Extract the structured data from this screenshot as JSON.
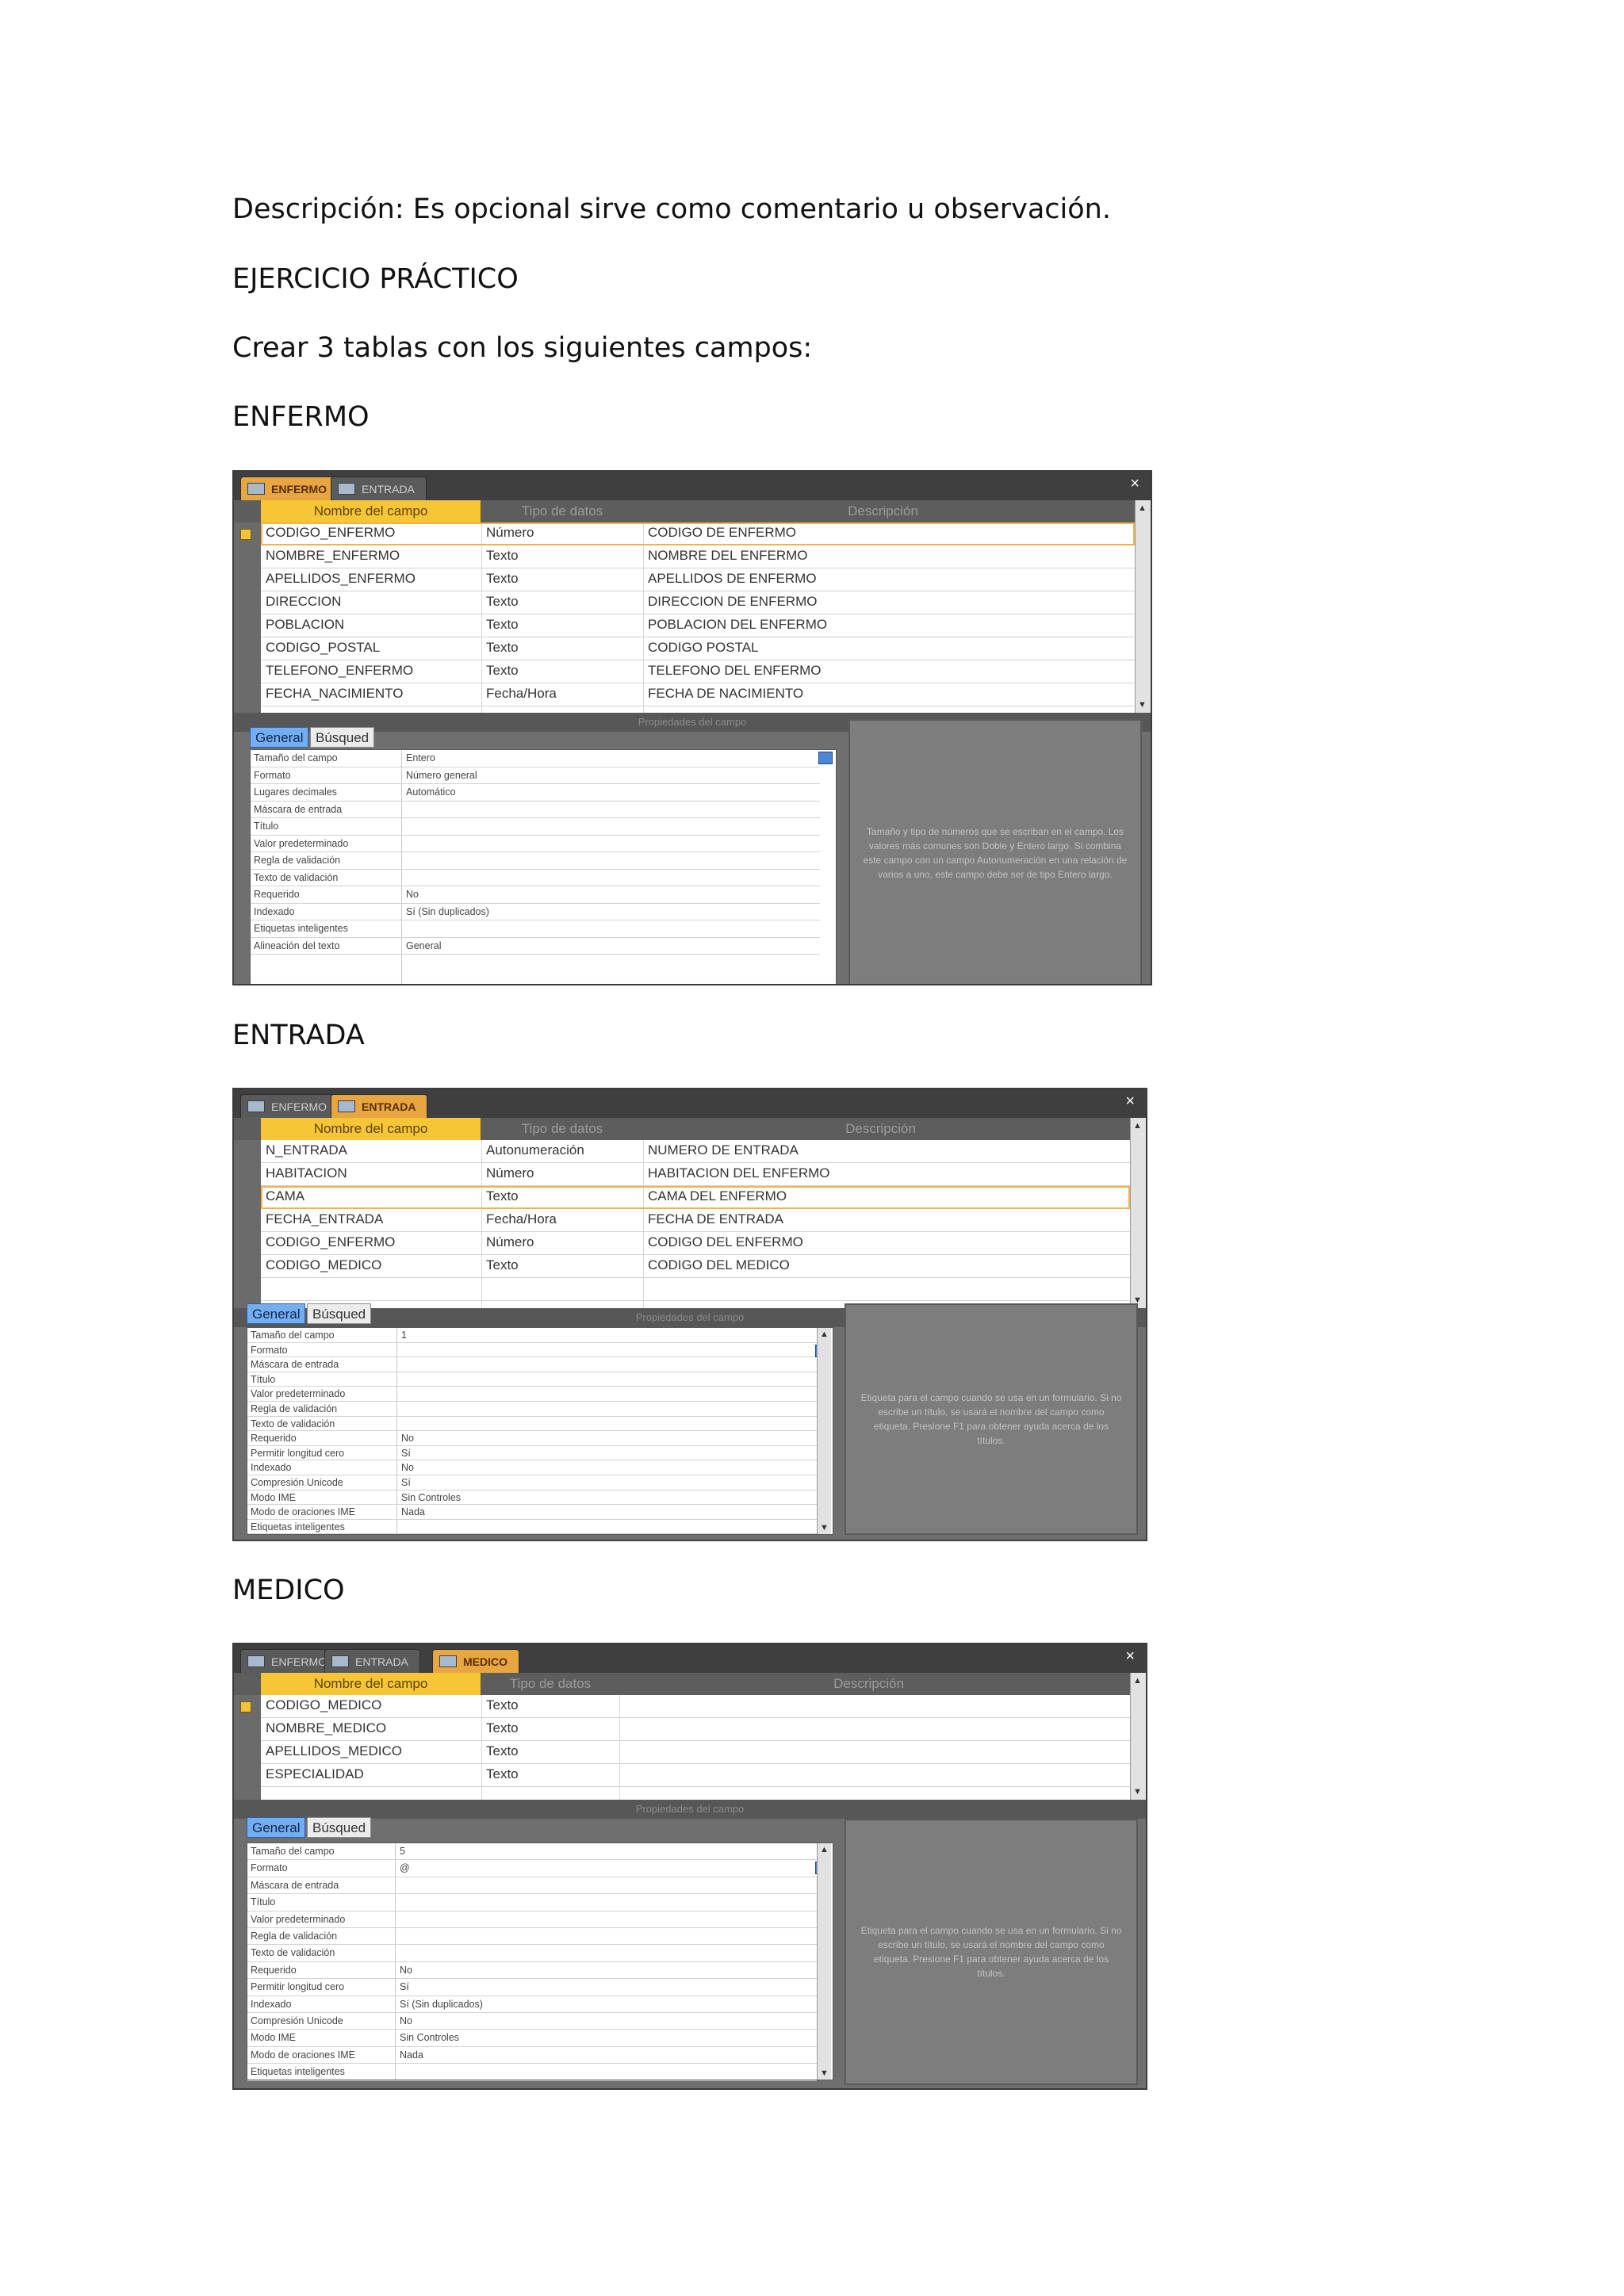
{
  "paragraphs": {
    "descripcion": "Descripción: Es opcional sirve como comentario u observación.",
    "ejercicio": "EJERCICIO PRÁCTICO",
    "crear": "Crear 3 tablas con los siguientes campos:"
  },
  "headings": {
    "enfermo": "ENFERMO",
    "entrada": "ENTRADA",
    "medico": "MEDICO"
  },
  "common": {
    "col_field": "Nombre del campo",
    "col_type": "Tipo de datos",
    "col_desc": "Descripción",
    "props_bar": "Propiedades del campo",
    "tab_general": "General",
    "tab_busqueda": "Búsqued",
    "close_glyph": "×",
    "scroll_up_glyph": "▲",
    "scroll_down_glyph": "▼"
  },
  "enfermo": {
    "tabs": [
      "ENFERMO",
      "ENTRADA"
    ],
    "fields": [
      {
        "name": "CODIGO_ENFERMO",
        "type": "Número",
        "desc": "CODIGO DE ENFERMO"
      },
      {
        "name": "NOMBRE_ENFERMO",
        "type": "Texto",
        "desc": "NOMBRE DEL ENFERMO"
      },
      {
        "name": "APELLIDOS_ENFERMO",
        "type": "Texto",
        "desc": "APELLIDOS DE ENFERMO"
      },
      {
        "name": "DIRECCION",
        "type": "Texto",
        "desc": "DIRECCION DE ENFERMO"
      },
      {
        "name": "POBLACION",
        "type": "Texto",
        "desc": "POBLACION DEL ENFERMO"
      },
      {
        "name": "CODIGO_POSTAL",
        "type": "Texto",
        "desc": "CODIGO POSTAL"
      },
      {
        "name": "TELEFONO_ENFERMO",
        "type": "Texto",
        "desc": "TELEFONO DEL ENFERMO"
      },
      {
        "name": "FECHA_NACIMIENTO",
        "type": "Fecha/Hora",
        "desc": "FECHA DE NACIMIENTO"
      }
    ],
    "props": [
      {
        "label": "Tamaño del campo",
        "value": "Entero"
      },
      {
        "label": "Formato",
        "value": "Número general"
      },
      {
        "label": "Lugares decimales",
        "value": "Automático"
      },
      {
        "label": "Máscara de entrada",
        "value": ""
      },
      {
        "label": "Título",
        "value": ""
      },
      {
        "label": "Valor predeterminado",
        "value": ""
      },
      {
        "label": "Regla de validación",
        "value": ""
      },
      {
        "label": "Texto de validación",
        "value": ""
      },
      {
        "label": "Requerido",
        "value": "No"
      },
      {
        "label": "Indexado",
        "value": "Sí (Sin duplicados)"
      },
      {
        "label": "Etiquetas inteligentes",
        "value": ""
      },
      {
        "label": "Alineación del texto",
        "value": "General"
      }
    ],
    "help": "Tamaño y tipo de números que se escriban en el campo. Los valores más comunes son Doble y Entero largo. Si combina este campo con un campo Autonumeración en una relación de varios a uno, este campo debe ser de tipo Entero largo."
  },
  "entrada": {
    "tabs": [
      "ENFERMO",
      "ENTRADA"
    ],
    "fields": [
      {
        "name": "N_ENTRADA",
        "type": "Autonumeración",
        "desc": "NUMERO DE ENTRADA"
      },
      {
        "name": "HABITACION",
        "type": "Número",
        "desc": "HABITACION DEL ENFERMO"
      },
      {
        "name": "CAMA",
        "type": "Texto",
        "desc": "CAMA DEL ENFERMO"
      },
      {
        "name": "FECHA_ENTRADA",
        "type": "Fecha/Hora",
        "desc": "FECHA DE ENTRADA"
      },
      {
        "name": "CODIGO_ENFERMO",
        "type": "Número",
        "desc": "CODIGO DEL ENFERMO"
      },
      {
        "name": "CODIGO_MEDICO",
        "type": "Texto",
        "desc": "CODIGO DEL MEDICO"
      }
    ],
    "props": [
      {
        "label": "Tamaño del campo",
        "value": "1"
      },
      {
        "label": "Formato",
        "value": ""
      },
      {
        "label": "Máscara de entrada",
        "value": ""
      },
      {
        "label": "Título",
        "value": ""
      },
      {
        "label": "Valor predeterminado",
        "value": ""
      },
      {
        "label": "Regla de validación",
        "value": ""
      },
      {
        "label": "Texto de validación",
        "value": ""
      },
      {
        "label": "Requerido",
        "value": "No"
      },
      {
        "label": "Permitir longitud cero",
        "value": "Sí"
      },
      {
        "label": "Indexado",
        "value": "No"
      },
      {
        "label": "Compresión Unicode",
        "value": "Sí"
      },
      {
        "label": "Modo IME",
        "value": "Sin Controles"
      },
      {
        "label": "Modo de oraciones IME",
        "value": "Nada"
      },
      {
        "label": "Etiquetas inteligentes",
        "value": ""
      }
    ],
    "help": "Etiqueta para el campo cuando se usa en un formulario. Si no escribe un título, se usará el nombre del campo como etiqueta. Presione F1 para obtener ayuda acerca de los títulos."
  },
  "medico": {
    "tabs": [
      "ENFERMO",
      "ENTRADA",
      "MEDICO"
    ],
    "fields": [
      {
        "name": "CODIGO_MEDICO",
        "type": "Texto",
        "desc": ""
      },
      {
        "name": "NOMBRE_MEDICO",
        "type": "Texto",
        "desc": ""
      },
      {
        "name": "APELLIDOS_MEDICO",
        "type": "Texto",
        "desc": ""
      },
      {
        "name": "ESPECIALIDAD",
        "type": "Texto",
        "desc": ""
      }
    ],
    "props": [
      {
        "label": "Tamaño del campo",
        "value": "5"
      },
      {
        "label": "Formato",
        "value": "@"
      },
      {
        "label": "Máscara de entrada",
        "value": ""
      },
      {
        "label": "Título",
        "value": ""
      },
      {
        "label": "Valor predeterminado",
        "value": ""
      },
      {
        "label": "Regla de validación",
        "value": ""
      },
      {
        "label": "Texto de validación",
        "value": ""
      },
      {
        "label": "Requerido",
        "value": "No"
      },
      {
        "label": "Permitir longitud cero",
        "value": "Sí"
      },
      {
        "label": "Indexado",
        "value": "Sí (Sin duplicados)"
      },
      {
        "label": "Compresión Unicode",
        "value": "No"
      },
      {
        "label": "Modo IME",
        "value": "Sin Controles"
      },
      {
        "label": "Modo de oraciones IME",
        "value": "Nada"
      },
      {
        "label": "Etiquetas inteligentes",
        "value": ""
      }
    ],
    "help": "Etiqueta para el campo cuando se usa en un formulario. Si no escribe un título, se usará el nombre del campo como etiqueta. Presione F1 para obtener ayuda acerca de los títulos."
  },
  "colors": {
    "active_tab": "#e7a640",
    "header_highlight": "#f6c637",
    "general_tab": "#74aef2",
    "panel_gray": "#6f6f6f"
  }
}
